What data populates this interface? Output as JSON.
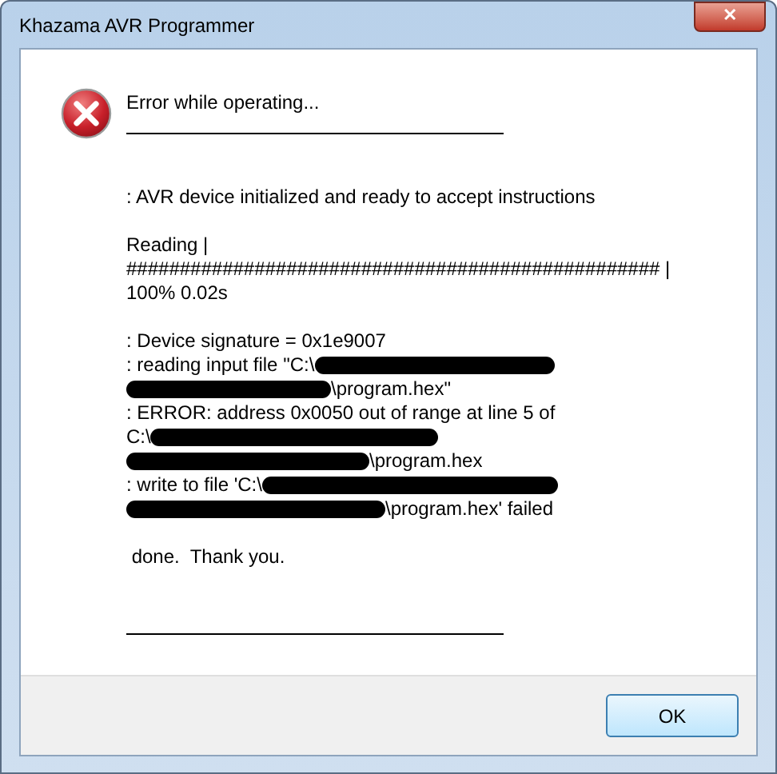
{
  "window": {
    "title": "Khazama AVR Programmer",
    "close_label": "✕"
  },
  "heading": "Error while operating...",
  "message": [
    {
      "lines": [
        {
          "parts": [
            {
              "kind": "text",
              "text": ": AVR device initialized and ready to accept instructions"
            }
          ]
        }
      ]
    },
    {
      "lines": [
        {
          "parts": [
            {
              "kind": "text",
              "text": "Reading |"
            }
          ]
        },
        {
          "parts": [
            {
              "kind": "text",
              "text": "################################################## |"
            }
          ]
        },
        {
          "parts": [
            {
              "kind": "text",
              "text": "100% 0.02s"
            }
          ]
        }
      ]
    },
    {
      "lines": [
        {
          "parts": [
            {
              "kind": "text",
              "text": ": Device signature = 0x1e9007"
            }
          ]
        },
        {
          "parts": [
            {
              "kind": "text",
              "text": ": reading input file \"C:\\"
            },
            {
              "kind": "redaction"
            }
          ]
        },
        {
          "parts": [
            {
              "kind": "redaction"
            },
            {
              "kind": "text",
              "text": "\\program.hex\""
            }
          ]
        },
        {
          "parts": [
            {
              "kind": "text",
              "text": ": ERROR: address 0x0050 out of range at line 5 of"
            }
          ]
        },
        {
          "parts": [
            {
              "kind": "text",
              "text": "C:\\"
            },
            {
              "kind": "redaction"
            }
          ]
        },
        {
          "parts": [
            {
              "kind": "redaction"
            },
            {
              "kind": "text",
              "text": "\\program.hex"
            }
          ]
        },
        {
          "parts": [
            {
              "kind": "text",
              "text": ": write to file 'C:\\"
            },
            {
              "kind": "redaction"
            }
          ]
        },
        {
          "parts": [
            {
              "kind": "redaction"
            },
            {
              "kind": "text",
              "text": "\\program.hex' failed"
            }
          ]
        }
      ]
    },
    {
      "lines": [
        {
          "parts": [
            {
              "kind": "text",
              "text": " done.  Thank you."
            }
          ]
        }
      ]
    }
  ],
  "buttons": [
    "OK"
  ]
}
